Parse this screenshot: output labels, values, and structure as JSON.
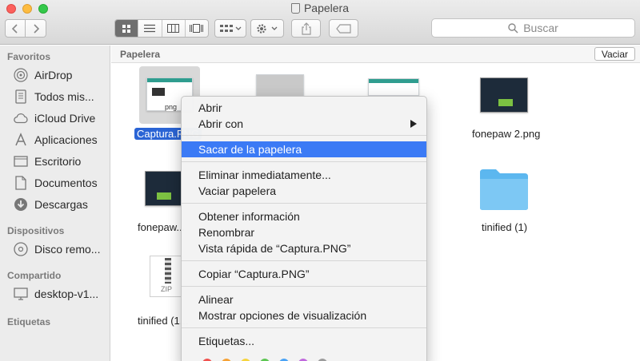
{
  "window": {
    "title": "Papelera"
  },
  "toolbar": {
    "search_placeholder": "Buscar",
    "view_modes": [
      "icons",
      "list",
      "columns",
      "cover-flow"
    ],
    "active_view": "icons"
  },
  "sidebar": {
    "sections": [
      {
        "title": "Favoritos",
        "items": [
          {
            "label": "AirDrop",
            "icon": "airdrop-icon"
          },
          {
            "label": "Todos mis...",
            "icon": "all-files-icon"
          },
          {
            "label": "iCloud Drive",
            "icon": "cloud-icon"
          },
          {
            "label": "Aplicaciones",
            "icon": "applications-icon"
          },
          {
            "label": "Escritorio",
            "icon": "desktop-icon"
          },
          {
            "label": "Documentos",
            "icon": "documents-icon"
          },
          {
            "label": "Descargas",
            "icon": "downloads-icon"
          }
        ]
      },
      {
        "title": "Dispositivos",
        "items": [
          {
            "label": "Disco remo...",
            "icon": "disc-icon"
          }
        ]
      },
      {
        "title": "Compartido",
        "items": [
          {
            "label": "desktop-v1...",
            "icon": "computer-icon"
          }
        ]
      },
      {
        "title": "Etiquetas",
        "items": []
      }
    ]
  },
  "pathbar": {
    "label": "Papelera",
    "empty_button": "Vaciar"
  },
  "files": {
    "f1_caption": "Captura.PNG",
    "f1_thumb_text": "png",
    "f4_caption": "fonepaw 2.png",
    "f5_caption": "fonepaw...",
    "f6_caption": "tinified (1)",
    "f7_caption": "tinified (1...",
    "f7_thumb_text": "ZIP"
  },
  "context_menu": {
    "items": [
      {
        "label": "Abrir"
      },
      {
        "label": "Abrir con",
        "submenu": true
      },
      {
        "label": "Sacar de la papelera",
        "highlighted": true
      },
      {
        "label": "Eliminar inmediatamente..."
      },
      {
        "label": "Vaciar papelera"
      },
      {
        "label": "Obtener información"
      },
      {
        "label": "Renombrar"
      },
      {
        "label": "Vista rápida de “Captura.PNG”"
      },
      {
        "label": "Copiar “Captura.PNG”"
      },
      {
        "label": "Alinear"
      },
      {
        "label": "Mostrar opciones de visualización"
      },
      {
        "label": "Etiquetas..."
      }
    ],
    "tag_colors": [
      "#f0524f",
      "#f5a236",
      "#f6d43e",
      "#5ec654",
      "#4aa3f5",
      "#c069dd",
      "#9c9c9c"
    ]
  }
}
